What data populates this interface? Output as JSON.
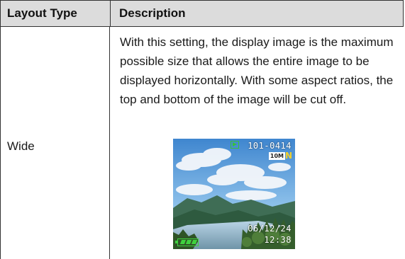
{
  "table": {
    "headers": [
      "Layout Type",
      "Description"
    ],
    "rows": [
      {
        "layout_type": "Wide",
        "description": "With this setting, the display image is the maximum possible size that allows the entire image to be displayed horizontally. With some aspect ratios, the top and bottom of the image will be cut off."
      }
    ]
  },
  "preview": {
    "file_number": "101-0414",
    "image_size": "10M",
    "quality": "N",
    "date": "06/12/24",
    "time": "12:38",
    "icons": [
      "play-icon",
      "battery-icon"
    ]
  }
}
